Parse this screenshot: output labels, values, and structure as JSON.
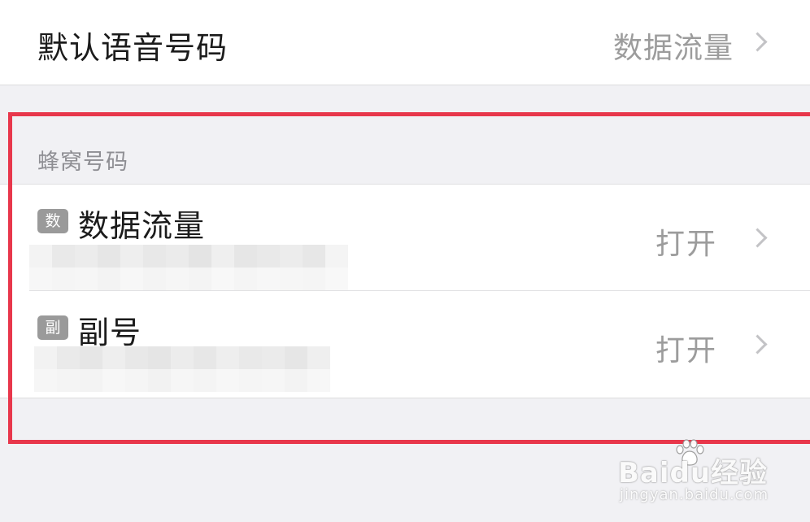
{
  "default_voice": {
    "title": "默认语音号码",
    "value": "数据流量"
  },
  "cellular_section": {
    "header": "蜂窝号码",
    "sims": [
      {
        "badge": "数",
        "name": "数据流量",
        "status": "打开"
      },
      {
        "badge": "副",
        "name": "副号",
        "status": "打开"
      }
    ]
  },
  "watermark": {
    "brand": "Baidu经验",
    "url": "jingyan.baidu.com"
  },
  "colors": {
    "annotation_red": "#e8374b",
    "badge_gray": "#9a9a9a",
    "secondary_text": "#9c9c9c",
    "background": "#f1f1f4"
  },
  "icons": [
    "chevron-right-icon",
    "sim-badge-icon",
    "baidu-paw-icon"
  ]
}
